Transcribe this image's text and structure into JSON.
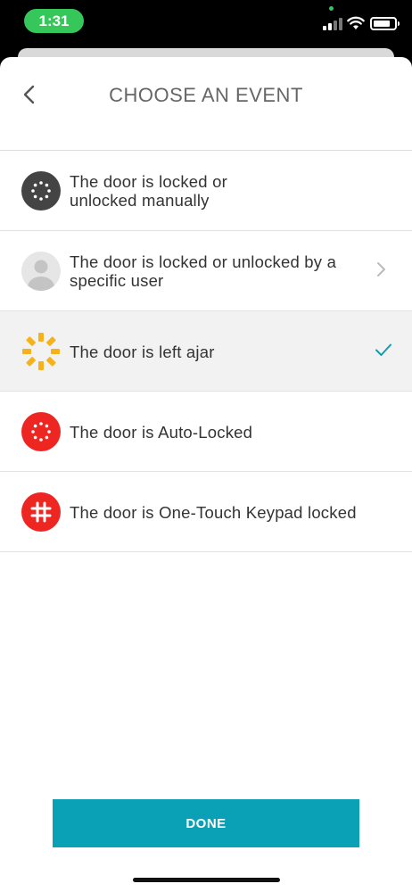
{
  "status_bar": {
    "time": "1:31",
    "accent_color": "#35c759"
  },
  "header": {
    "title": "CHOOSE AN EVENT",
    "back_icon": "chevron-left-icon"
  },
  "events": [
    {
      "label_line1": "The door is locked or",
      "label_line2": "unlocked manually",
      "icon": "manual-lock-icon",
      "icon_color": "#444444",
      "selected": false,
      "accessory": "none"
    },
    {
      "label_line1": "The door is locked or unlocked by a",
      "label_line2": "specific user",
      "icon": "user-avatar-icon",
      "icon_color": "#e6e6e6",
      "selected": false,
      "accessory": "chevron-right-icon"
    },
    {
      "label_line1": "The door is left ajar",
      "label_line2": "",
      "icon": "ajar-icon",
      "icon_color": "#f5b21b",
      "selected": true,
      "accessory": "checkmark-icon"
    },
    {
      "label_line1": "The door is Auto-Locked",
      "label_line2": "",
      "icon": "auto-lock-icon",
      "icon_color": "#ee2622",
      "selected": false,
      "accessory": "none"
    },
    {
      "label_line1": "The door is One-Touch Keypad locked",
      "label_line2": "",
      "icon": "keypad-hash-icon",
      "icon_color": "#ee2622",
      "selected": false,
      "accessory": "none"
    }
  ],
  "footer": {
    "done_label": "DONE",
    "done_color": "#0aa0b6"
  }
}
